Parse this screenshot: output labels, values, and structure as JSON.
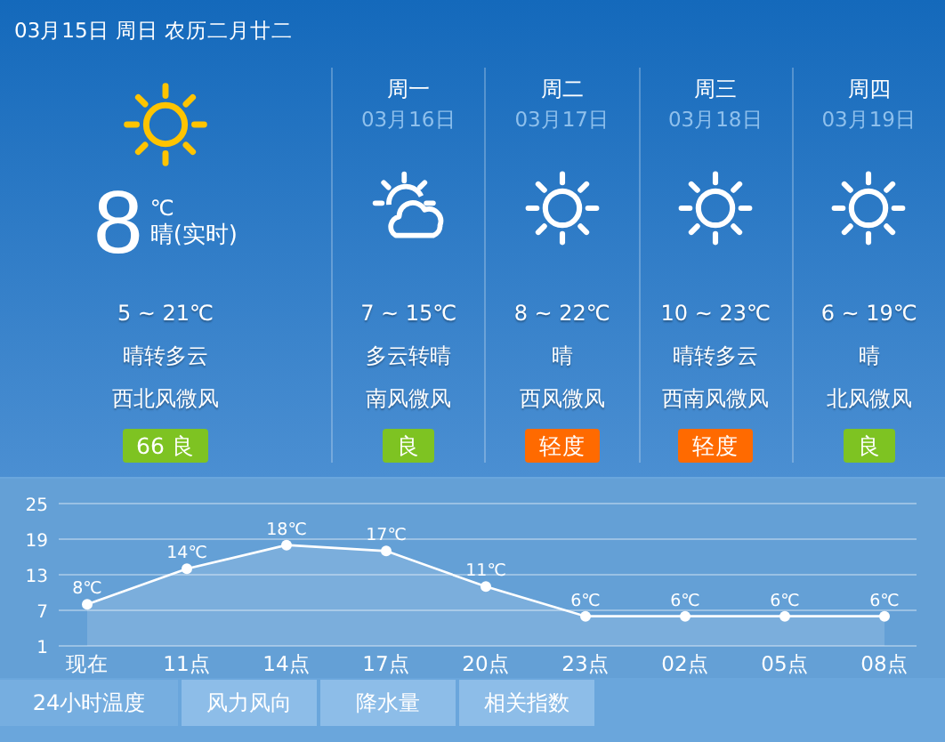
{
  "header": {
    "date": "03月15日 周日 农历二月廿二"
  },
  "today": {
    "kind": "sunny",
    "temp": "8",
    "unit": "℃",
    "desc": "晴(实时)",
    "range": "5 ~ 21℃",
    "weather": "晴转多云",
    "wind": "西北风微风",
    "aqi": "66 良",
    "color": "#7ec322"
  },
  "forecast": [
    {
      "day": "周一",
      "date": "03月16日",
      "kind": "partly-cloudy",
      "range": "7 ~ 15℃",
      "weather": "多云转晴",
      "wind": "南风微风",
      "aqi": "良",
      "color": "#7ec322"
    },
    {
      "day": "周二",
      "date": "03月17日",
      "kind": "sunny",
      "range": "8 ~ 22℃",
      "weather": "晴",
      "wind": "西风微风",
      "aqi": "轻度",
      "color": "#ff6a00"
    },
    {
      "day": "周三",
      "date": "03月18日",
      "kind": "sunny",
      "range": "10 ~ 23℃",
      "weather": "晴转多云",
      "wind": "西南风微风",
      "aqi": "轻度",
      "color": "#ff6a00"
    },
    {
      "day": "周四",
      "date": "03月19日",
      "kind": "sunny",
      "range": "6 ~ 19℃",
      "weather": "晴",
      "wind": "北风微风",
      "aqi": "良",
      "color": "#7ec322"
    }
  ],
  "chart_data": {
    "type": "line",
    "categories": [
      "现在",
      "11点",
      "14点",
      "17点",
      "20点",
      "23点",
      "02点",
      "05点",
      "08点"
    ],
    "series": [
      {
        "color": "#ffffff",
        "marker": "circle",
        "values": [
          8,
          14,
          18,
          17,
          11,
          6,
          6,
          6,
          6
        ]
      }
    ],
    "ylim": [
      1,
      25
    ],
    "yticks": [
      1,
      7,
      13,
      19,
      25
    ],
    "grid": true,
    "value_labels": [
      "8℃",
      "14℃",
      "18℃",
      "17℃",
      "11℃",
      "6℃",
      "6℃",
      "6℃",
      "6℃"
    ]
  },
  "tabs": [
    {
      "label": "24小时温度",
      "selected": true
    },
    {
      "label": "风力风向",
      "selected": false
    },
    {
      "label": "降水量",
      "selected": false
    },
    {
      "label": "相关指数",
      "selected": false
    }
  ]
}
